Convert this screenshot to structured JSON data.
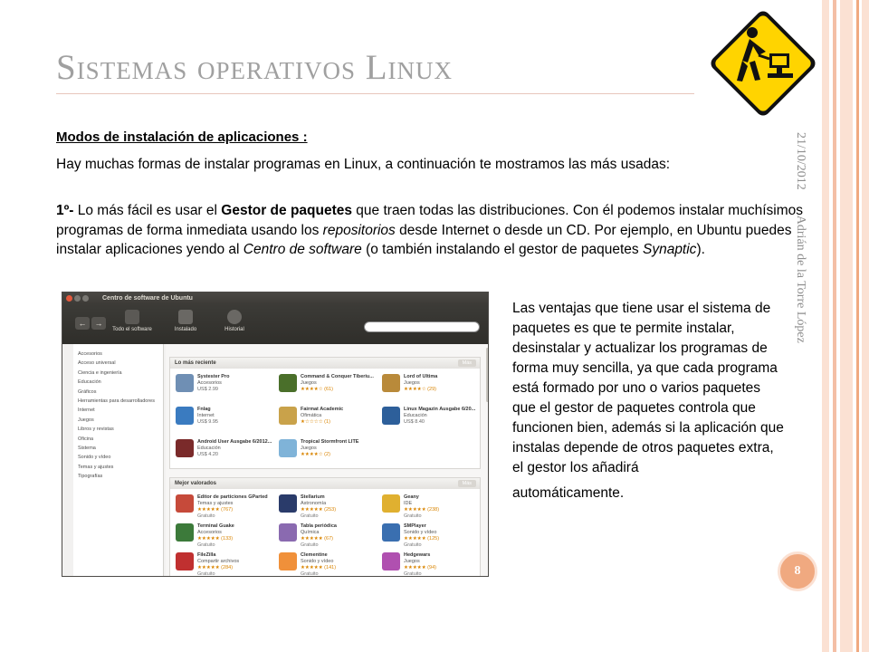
{
  "slide": {
    "title": "Sistemas operativos Linux",
    "subheading": "Modos de instalación de aplicaciones :",
    "intro": "Hay muchas formas de instalar programas en Linux, a continuación te mostramos las más usadas:",
    "para": {
      "num": "1º-",
      "t1": " Lo más fácil es usar el ",
      "b1": "Gestor de paquetes",
      "t2": " que traen todas las distribuciones. Con él podemos instalar muchísimos programas de forma inmediata usando los ",
      "i1": "repositorios",
      "t3": " desde Internet o desde un CD. Por ejemplo, en Ubuntu puedes instalar aplicaciones yendo al ",
      "i2": "Centro de software",
      "t4": " (o también instalando el gestor de paquetes ",
      "i3": "Synaptic",
      "t5": ")."
    },
    "side_text": "Las ventajas que tiene usar el sistema de paquetes es que te permite instalar, desinstalar y actualizar los programas de forma muy sencilla, ya que cada programa está formado por uno o varios paquetes que el gestor de paquetes controla que funcionen bien, además si la aplicación que instalas depende de otros paquetes extra, el gestor los añadirá",
    "side_last": "automáticamente.",
    "date": "21/10/2012",
    "author": "Adrián de la Torre López",
    "page_number": "8"
  },
  "colors": {
    "title": "#a0a0a0",
    "accent": "#f0a980",
    "sign_yellow": "#ffd400"
  },
  "software_center": {
    "window_title": "Centro de software de Ubuntu",
    "toolbar": {
      "all": "Todo el software",
      "installed": "Instalado",
      "history": "Historial"
    },
    "categories": [
      "Accesorios",
      "Acceso universal",
      "Ciencia e ingeniería",
      "Educación",
      "Gráficos",
      "Herramientas para desarrolladores",
      "Internet",
      "Juegos",
      "Libros y revistas",
      "Oficina",
      "Sistema",
      "Sonido y vídeo",
      "Temas y ajustes",
      "Tipografías"
    ],
    "recent_title": "Lo más reciente",
    "top_title": "Mejor valorados",
    "more": "Más",
    "recent": [
      {
        "name": "Systester Pro",
        "cat": "Accesorios",
        "extra": "US$ 2.99",
        "icon": "#6f8fb4"
      },
      {
        "name": "Command & Conquer Tiberiu...",
        "cat": "Juegos",
        "extra": "★★★★☆ (61)",
        "icon": "#4a6f2a"
      },
      {
        "name": "Lord of Ultima",
        "cat": "Juegos",
        "extra": "★★★★☆ (29)",
        "icon": "#b98a3a"
      },
      {
        "name": "Fnlag",
        "cat": "Internet",
        "extra": "US$ 9.95",
        "icon": "#3a7bc0"
      },
      {
        "name": "Fairmat Academic",
        "cat": "Ofimática",
        "extra": "★☆☆☆☆ (1)",
        "icon": "#c9a24a"
      },
      {
        "name": "Linux Magazin Ausgabe 6/20...",
        "cat": "Educación",
        "extra": "US$ 8.40",
        "icon": "#2d5f9a"
      },
      {
        "name": "Android User Ausgabe 6/2012...",
        "cat": "Educación",
        "extra": "US$ 4.20",
        "icon": "#7a2a2a"
      },
      {
        "name": "Tropical Stormfront LITE",
        "cat": "Juegos",
        "extra": "★★★★☆ (2)",
        "icon": "#7fb3d8"
      }
    ],
    "top": [
      {
        "name": "Editor de particiones GParted",
        "cat": "Temas y ajustes",
        "extra": "★★★★★ (767)",
        "icon": "#c64a3a"
      },
      {
        "name": "Stellarium",
        "cat": "Astronomía",
        "extra": "★★★★★ (253)",
        "icon": "#2a3b6a"
      },
      {
        "name": "Geany",
        "cat": "IDE",
        "extra": "★★★★★ (238)",
        "icon": "#e0b030"
      },
      {
        "name": "Terminal Guake",
        "cat": "Accesorios",
        "extra": "★★★★★ (133)",
        "icon": "#3c7a3a"
      },
      {
        "name": "Tabla periódica",
        "cat": "Química",
        "extra": "★★★★★ (67)",
        "icon": "#8a6ab0"
      },
      {
        "name": "SMPlayer",
        "cat": "Sonido y vídeo",
        "extra": "★★★★★ (125)",
        "icon": "#3a6fb0"
      },
      {
        "name": "FileZilla",
        "cat": "Compartir archivos",
        "extra": "★★★★★ (284)",
        "icon": "#c03030"
      },
      {
        "name": "Clementine",
        "cat": "Sonido y vídeo",
        "extra": "★★★★★ (141)",
        "icon": "#f0903a"
      },
      {
        "name": "Hedgewars",
        "cat": "Juegos",
        "extra": "★★★★★ (94)",
        "icon": "#b050b0"
      }
    ],
    "free": "Gratuito"
  }
}
